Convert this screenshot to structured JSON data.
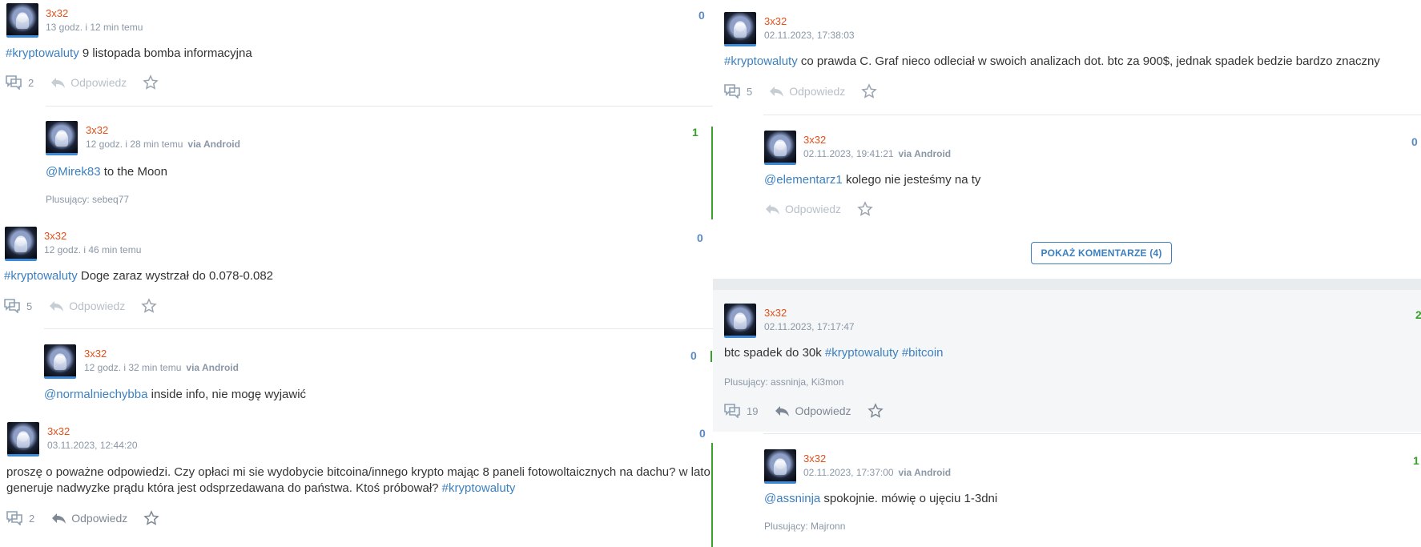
{
  "left": {
    "p1": {
      "user": "3x32",
      "time": "13 godz. i 12 min temu",
      "score": "0",
      "tag": "#kryptowaluty",
      "text": " 9 listopada bomba informacyjna",
      "comments": "2",
      "reply": "Odpowiedz"
    },
    "p2": {
      "user": "3x32",
      "time": "12 godz. i 28 min temu",
      "via": "via Android",
      "score": "1",
      "mention": "@Mirek83",
      "text": " to the Moon",
      "plus": "Plusujący: sebeq77"
    },
    "p3": {
      "user": "3x32",
      "time": "12 godz. i 46 min temu",
      "score": "0",
      "tag": "#kryptowaluty",
      "text": " Doge zaraz wystrzał do 0.078-0.082",
      "comments": "5",
      "reply": "Odpowiedz"
    },
    "p4": {
      "user": "3x32",
      "time": "12 godz. i 32 min temu",
      "via": "via Android",
      "score": "0",
      "mention": "@normalniechybba",
      "text": " inside info, nie mogę wyjawić"
    },
    "p5": {
      "user": "3x32",
      "time": "03.11.2023, 12:44:20",
      "score": "0",
      "text1": "proszę o poważne odpowiedzi. Czy opłaci mi sie wydobycie bitcoina/innego krypto mając 8 paneli fotowoltaicznych na dachu? w lato",
      "text2": "generuje nadwyzke prądu która jest odsprzedawana do państwa. Ktoś próbował? ",
      "tag": "#kryptowaluty",
      "comments": "2",
      "reply": "Odpowiedz"
    }
  },
  "right": {
    "p1": {
      "user": "3x32",
      "time": "02.11.2023, 17:38:03",
      "tag": "#kryptowaluty",
      "text": " co prawda C. Graf nieco odleciał w swoich analizach dot. btc za 900$, jednak spadek bedzie bardzo znaczny",
      "comments": "5",
      "reply": "Odpowiedz"
    },
    "p2": {
      "user": "3x32",
      "time": "02.11.2023, 19:41:21",
      "via": "via Android",
      "score": "0",
      "mention": "@elementarz1",
      "text": " kolego nie jesteśmy na ty",
      "reply": "Odpowiedz"
    },
    "show_more": "POKAŻ KOMENTARZE (4)",
    "p3": {
      "user": "3x32",
      "time": "02.11.2023, 17:17:47",
      "score": "2",
      "text": "btc spadek do 30k ",
      "tag1": "#kryptowaluty",
      "sep": " ",
      "tag2": "#bitcoin",
      "plus": "Plusujący: assninja, Ki3mon",
      "comments": "19",
      "reply": "Odpowiedz"
    },
    "p4": {
      "user": "3x32",
      "time": "02.11.2023, 17:37:00",
      "via": "via Android",
      "score": "1",
      "mention": "@assninja",
      "text": " spokojnie. mówię o ujęciu 1-3dni",
      "plus": "Plusujący: Majronn"
    }
  }
}
